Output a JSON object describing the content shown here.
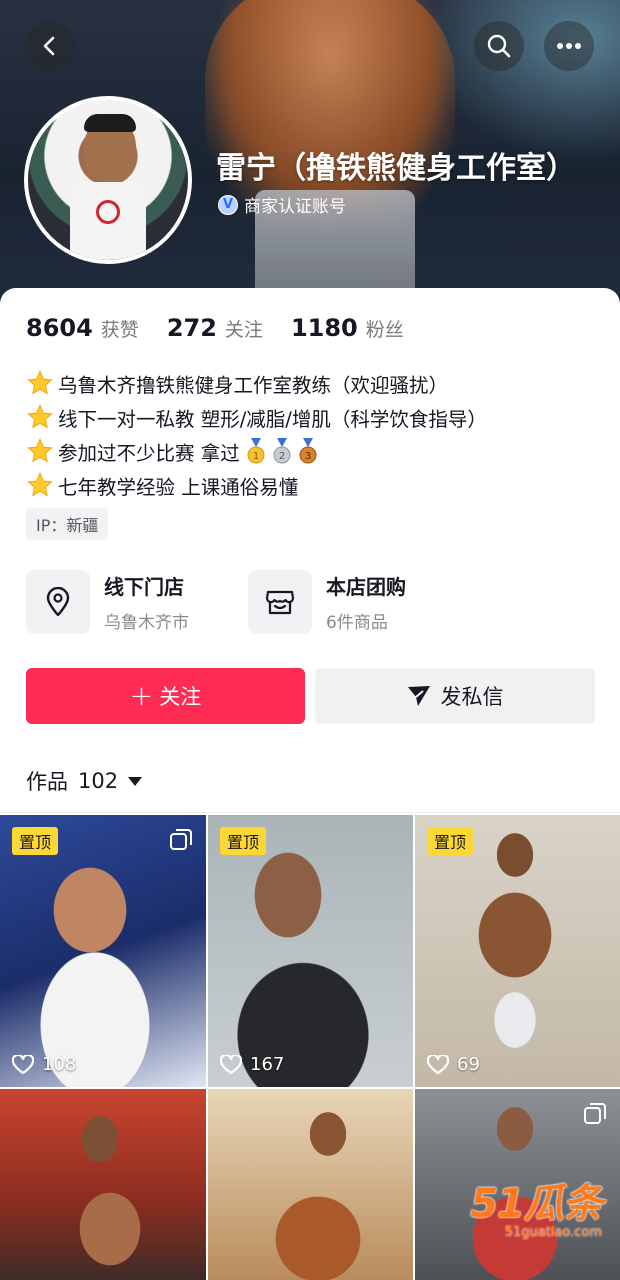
{
  "profile": {
    "name": "雷宁（撸铁熊健身工作室）",
    "verification": "商家认证账号",
    "verify_mark": "V"
  },
  "stats": [
    {
      "value": "8604",
      "label": "获赞"
    },
    {
      "value": "272",
      "label": "关注"
    },
    {
      "value": "1180",
      "label": "粉丝"
    }
  ],
  "bio": [
    "乌鲁木齐撸铁熊健身工作室教练（欢迎骚扰）",
    "线下一对一私教 塑形/减脂/增肌（科学饮食指导）",
    "参加过不少比赛  拿过",
    "七年教学经验  上课通俗易懂"
  ],
  "ip": "IP：新疆",
  "store": {
    "title": "线下门店",
    "subtitle": "乌鲁木齐市"
  },
  "group_buy": {
    "title": "本店团购",
    "subtitle": "6件商品"
  },
  "actions": {
    "follow": "关注",
    "message": "发私信"
  },
  "works": {
    "label": "作品",
    "count": "102"
  },
  "videos": [
    {
      "pinned": "置顶",
      "likes": "108",
      "multi": true
    },
    {
      "pinned": "置顶",
      "likes": "167",
      "multi": false
    },
    {
      "pinned": "置顶",
      "likes": "69",
      "multi": false
    },
    {
      "pinned": "",
      "likes": "",
      "multi": false
    },
    {
      "pinned": "",
      "likes": "",
      "multi": false
    },
    {
      "pinned": "",
      "likes": "",
      "multi": true
    }
  ],
  "watermark": {
    "main": "51瓜条",
    "sub": "51guatiao.com"
  },
  "colors": {
    "accent": "#fe2c55",
    "pin_badge": "#fdd835",
    "verify_blue": "#2f6bff"
  },
  "icons": [
    "back-icon",
    "search-icon",
    "more-icon",
    "star-icon",
    "gold-medal-icon",
    "silver-medal-icon",
    "bronze-medal-icon",
    "location-pin-icon",
    "store-icon",
    "plus-icon",
    "send-icon",
    "caret-down-icon",
    "heart-icon",
    "multi-image-icon"
  ]
}
